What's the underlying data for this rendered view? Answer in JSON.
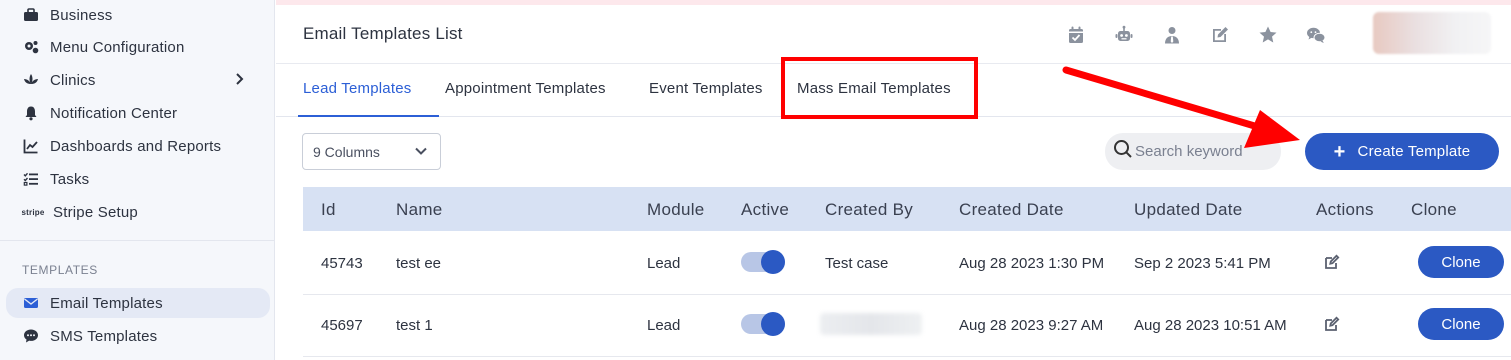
{
  "sidebar": {
    "items": [
      {
        "label": "Business",
        "icon": "briefcase-icon"
      },
      {
        "label": "Menu Configuration",
        "icon": "gears-icon"
      },
      {
        "label": "Clinics",
        "icon": "lotus-icon"
      },
      {
        "label": "Notification Center",
        "icon": "bell-icon"
      },
      {
        "label": "Dashboards and Reports",
        "icon": "chart-line-icon"
      },
      {
        "label": "Tasks",
        "icon": "tasks-icon"
      },
      {
        "label": "Stripe Setup",
        "icon": "stripe-icon"
      }
    ],
    "section_label": "TEMPLATES",
    "template_items": [
      {
        "label": "Email Templates",
        "icon": "envelope-icon",
        "active": true
      },
      {
        "label": "SMS Templates",
        "icon": "chat-bubble-icon"
      }
    ],
    "stripe_text": "stripe"
  },
  "header": {
    "title": "Email Templates List",
    "icons": [
      "calendar-check-icon",
      "robot-icon",
      "user-tie-icon",
      "edit-icon",
      "star-icon",
      "wechat-icon"
    ]
  },
  "tabs": [
    {
      "label": "Lead Templates",
      "active": true
    },
    {
      "label": "Appointment Templates"
    },
    {
      "label": "Event Templates"
    },
    {
      "label": "Mass Email Templates",
      "highlighted": true
    }
  ],
  "toolbar": {
    "columns_select": "9 Columns",
    "search_placeholder": "Search keyword",
    "create_button": "Create Template"
  },
  "table": {
    "columns": [
      "Id",
      "Name",
      "Module",
      "Active",
      "Created By",
      "Created Date",
      "Updated Date",
      "Actions",
      "Clone"
    ],
    "rows": [
      {
        "id": "45743",
        "name": "test ee",
        "module": "Lead",
        "active": true,
        "created_by": "Test case",
        "created_date": "Aug 28 2023 1:30 PM",
        "updated_date": "Sep 2 2023 5:41 PM",
        "clone": "Clone"
      },
      {
        "id": "45697",
        "name": "test 1",
        "module": "Lead",
        "active": true,
        "created_by": "",
        "created_date": "Aug 28 2023 9:27 AM",
        "updated_date": "Aug 28 2023 10:51 AM",
        "clone": "Clone"
      }
    ]
  },
  "colors": {
    "accent": "#2b59c3",
    "annotation": "#ff0000",
    "table_header_bg": "#d7e1f3"
  }
}
